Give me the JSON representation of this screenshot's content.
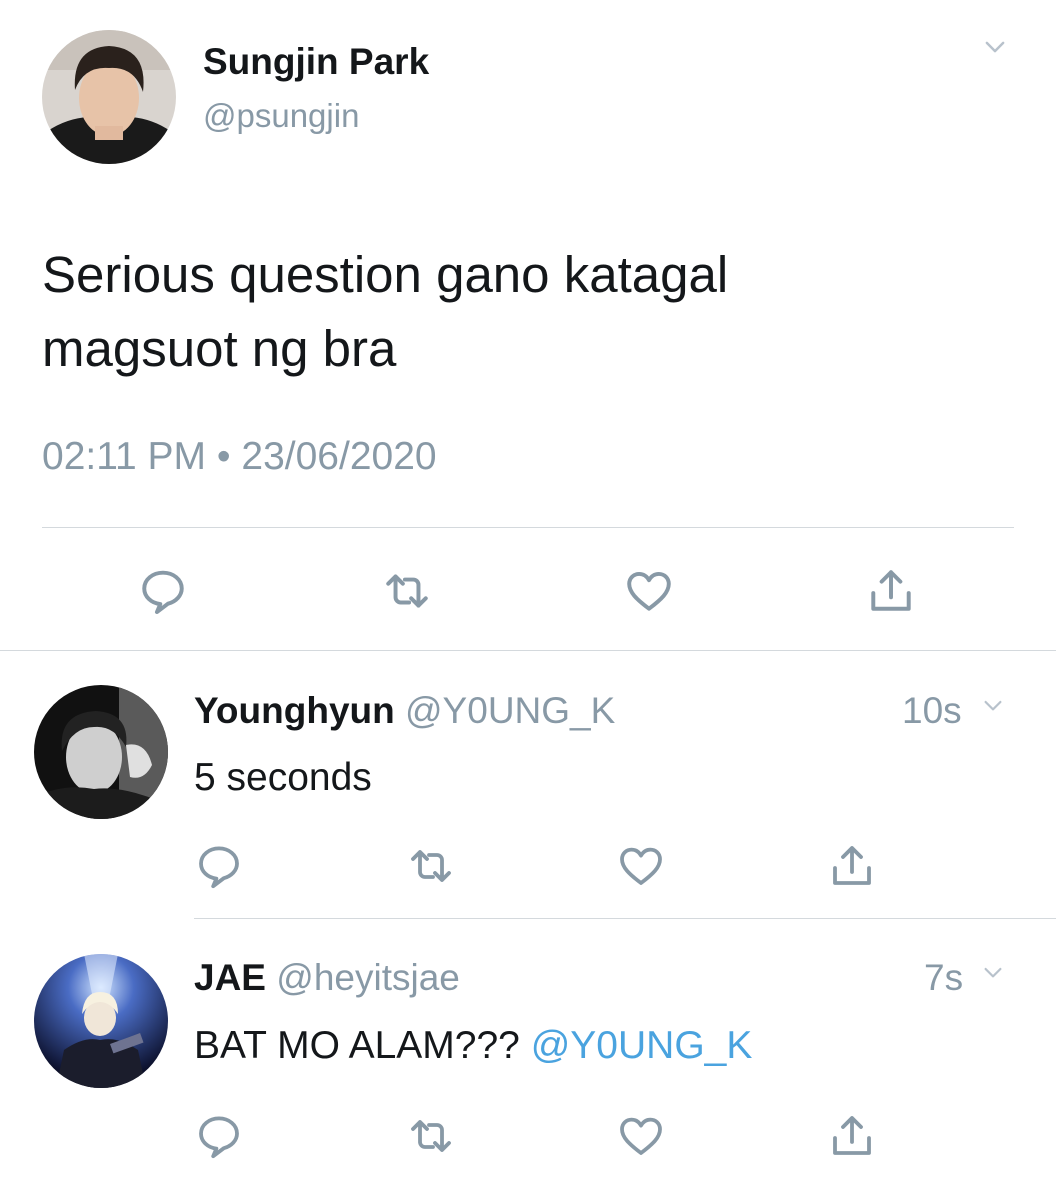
{
  "main_tweet": {
    "author_name": "Sungjin Park",
    "author_handle": "@psungjin",
    "text_line1": "Serious question gano katagal",
    "text_line2": "magsuot ng bra",
    "time": "02:11 PM",
    "separator": "•",
    "date": "23/06/2020",
    "menu_icon": "chevron-down-icon",
    "actions": [
      "reply-icon",
      "retweet-icon",
      "like-icon",
      "share-icon"
    ]
  },
  "replies": [
    {
      "author_name": "Younghyun",
      "author_handle": "@Y0UNG_K",
      "age": "10s",
      "text": "5 seconds",
      "actions": [
        "reply-icon",
        "retweet-icon",
        "like-icon",
        "share-icon"
      ]
    },
    {
      "author_name": "JAE",
      "author_handle": "@heyitsjae",
      "age": "7s",
      "text": "BAT MO ALAM??? ",
      "mention": "@Y0UNG_K",
      "actions": [
        "reply-icon",
        "retweet-icon",
        "like-icon",
        "share-icon"
      ]
    }
  ],
  "colors": {
    "text": "#14171a",
    "muted": "#8899a6",
    "link": "#4aa3df",
    "divider": "#d4d9dd"
  }
}
